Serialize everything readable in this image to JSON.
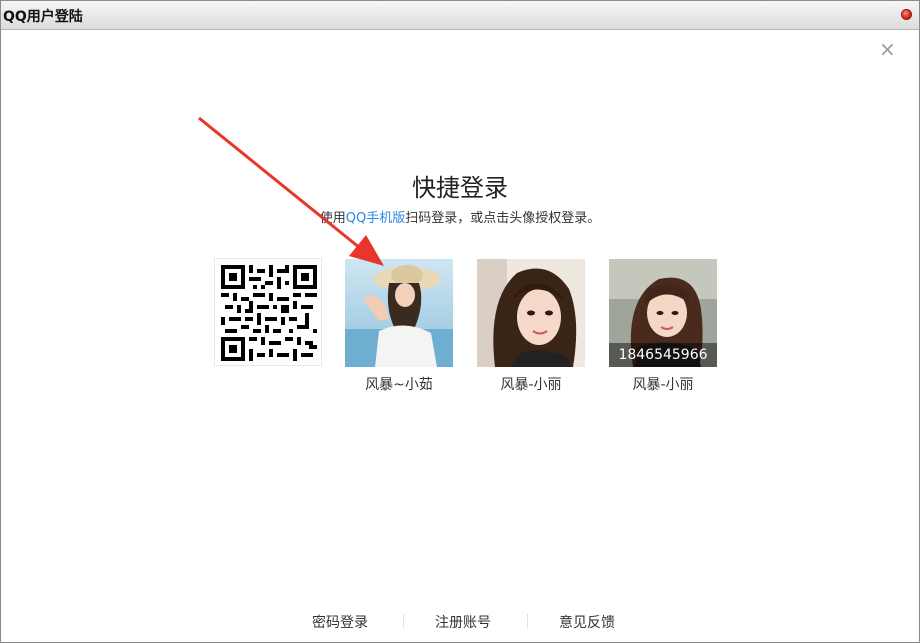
{
  "window": {
    "title": "QQ用户登陆"
  },
  "panel": {
    "heading": "快捷登录",
    "subtitle_before": "使用",
    "subtitle_link": "QQ手机版",
    "subtitle_after": "扫码登录，或点击头像授权登录。"
  },
  "accounts": [
    {
      "name": "风暴~小茹",
      "qq": ""
    },
    {
      "name": "风暴-小丽",
      "qq": ""
    },
    {
      "name": "风暴-小丽",
      "qq": "1846545966"
    }
  ],
  "footer": {
    "password_login": "密码登录",
    "register": "注册账号",
    "feedback": "意见反馈"
  },
  "colors": {
    "link": "#2a86e6",
    "annotation_arrow": "#e8362b"
  }
}
